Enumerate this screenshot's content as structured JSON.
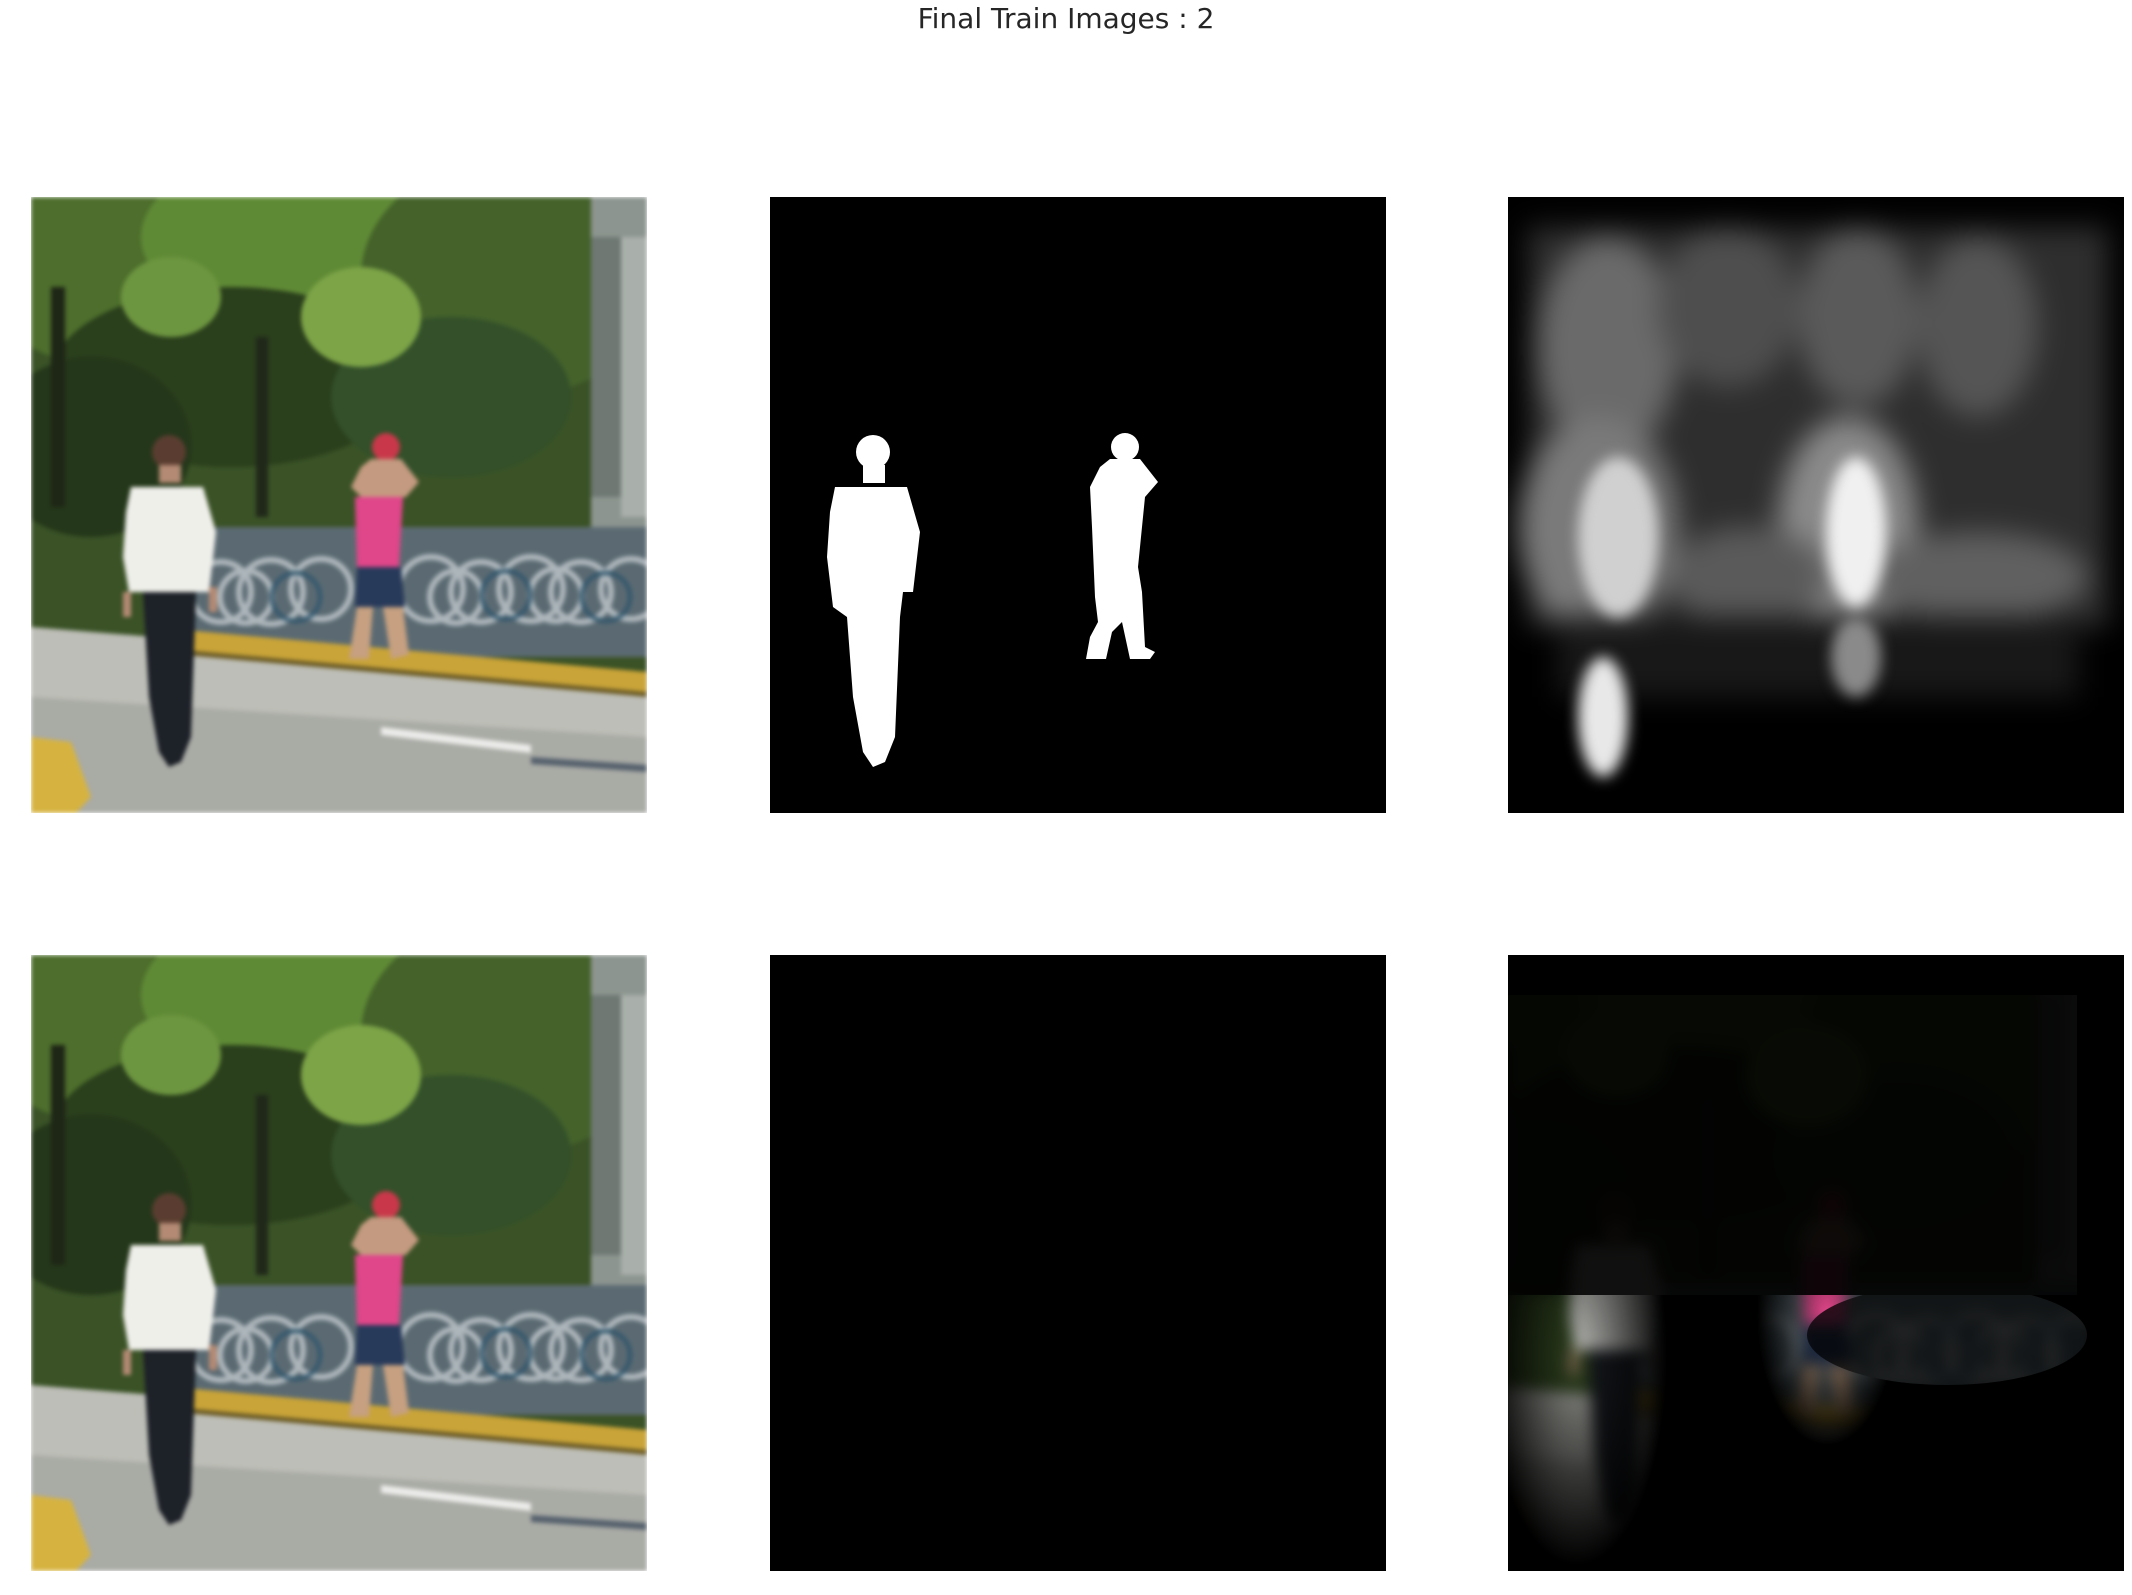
{
  "figure": {
    "title": "Final Train Images : 2"
  },
  "panels": [
    {
      "row": 1,
      "col": 1,
      "kind": "input-photo"
    },
    {
      "row": 1,
      "col": 2,
      "kind": "ground-truth-mask"
    },
    {
      "row": 1,
      "col": 3,
      "kind": "predicted-mask"
    },
    {
      "row": 2,
      "col": 1,
      "kind": "input-photo"
    },
    {
      "row": 2,
      "col": 2,
      "kind": "photo-masked-by-ground-truth"
    },
    {
      "row": 2,
      "col": 3,
      "kind": "photo-masked-by-prediction"
    }
  ],
  "colors": {
    "background": "#ffffff",
    "foliage": "#2f4a1f",
    "road": "#b9bab4",
    "curb": "#c7a63a",
    "shirt_white": "#eeeeea",
    "shirt_pink": "#e0468a",
    "pants_dark": "#1d2128"
  }
}
